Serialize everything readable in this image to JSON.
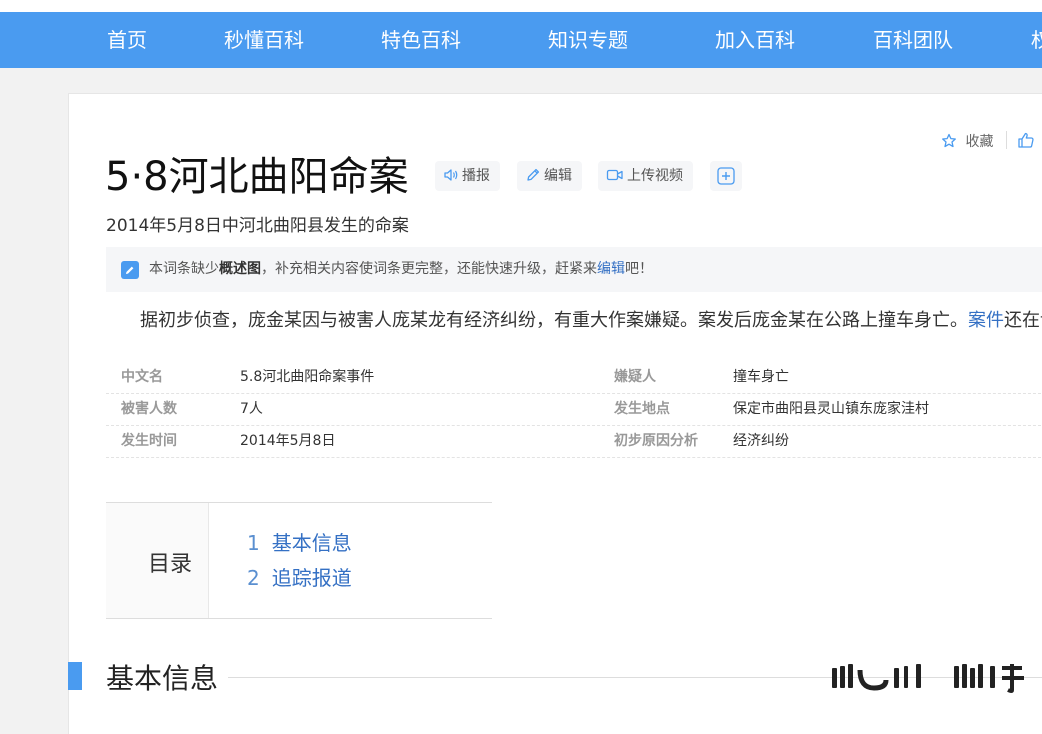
{
  "nav": {
    "items": [
      "首页",
      "秒懂百科",
      "特色百科",
      "知识专题",
      "加入百科",
      "百科团队",
      "权"
    ]
  },
  "article": {
    "title": "5·8河北曲阳命案",
    "subtitle": "2014年5月8日中河北曲阳县发生的命案",
    "tools": {
      "play": "播报",
      "edit": "编辑",
      "upload_video": "上传视频"
    },
    "favorite": "收藏"
  },
  "notice": {
    "prefix": "本词条缺少",
    "bold": "概述图",
    "middle": "，补充相关内容使词条更完整，还能快速升级，赶紧来",
    "link": "编辑",
    "suffix": "吧！"
  },
  "summary": {
    "text": "据初步侦查，庞金某因与被害人庞某龙有经济纠纷，有重大作案嫌疑。案发后庞金某在公路上撞车身亡。",
    "link": "案件",
    "tail": "还在调查"
  },
  "infobox": [
    {
      "label": "中文名",
      "value": "5.8河北曲阳命案事件"
    },
    {
      "label": "嫌疑人",
      "value": "撞车身亡"
    },
    {
      "label": "被害人数",
      "value": "7人"
    },
    {
      "label": "发生地点",
      "value": "保定市曲阳县灵山镇东庞家洼村"
    },
    {
      "label": "发生时间",
      "value": "2014年5月8日"
    },
    {
      "label": "初步原因分析",
      "value": "经济纠纷"
    }
  ],
  "toc": {
    "title": "目录",
    "items": [
      {
        "num": "1",
        "label": "基本信息"
      },
      {
        "num": "2",
        "label": "追踪报道"
      }
    ]
  },
  "section": {
    "title": "基本信息"
  },
  "colors": {
    "nav_bg": "#4a9bf0",
    "link": "#3470c4",
    "section_bar": "#4a9bf0"
  }
}
